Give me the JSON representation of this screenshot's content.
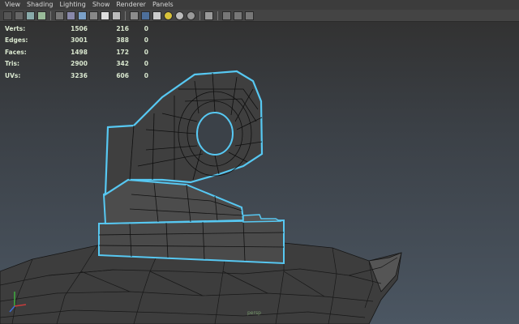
{
  "menu": [
    "View",
    "Shading",
    "Lighting",
    "Show",
    "Renderer",
    "Panels"
  ],
  "toolbar": {
    "icons": [
      "camera-attr-icon",
      "camera-icon",
      "bookmark-icon",
      "image-plane-icon",
      "grid-toggle-icon",
      "wireframe-icon",
      "smooth-shade-icon",
      "bounding-box-icon",
      "textured-icon",
      "use-lights-icon",
      "shadows-icon",
      "xray-icon",
      "default-material-icon",
      "light-bulb-icon",
      "isolate-select-icon",
      "resolution-gate-icon",
      "film-gate-icon",
      "safe-area-icon"
    ]
  },
  "hud": {
    "rows": [
      {
        "label": "Verts:",
        "v1": "1506",
        "v2": "216",
        "v3": "0"
      },
      {
        "label": "Edges:",
        "v1": "3001",
        "v2": "388",
        "v3": "0"
      },
      {
        "label": "Faces:",
        "v1": "1498",
        "v2": "172",
        "v3": "0"
      },
      {
        "label": "Tris:",
        "v1": "2900",
        "v2": "342",
        "v3": "0"
      },
      {
        "label": "UVs:",
        "v1": "3236",
        "v2": "606",
        "v3": "0"
      }
    ]
  },
  "viewport": {
    "camera": "persp",
    "selection_color": "#57c8f2",
    "mesh_color": "#3e3e3e",
    "wire_color": "#111111"
  },
  "axis": {
    "y": "Y",
    "x": "X",
    "z": "Z"
  }
}
